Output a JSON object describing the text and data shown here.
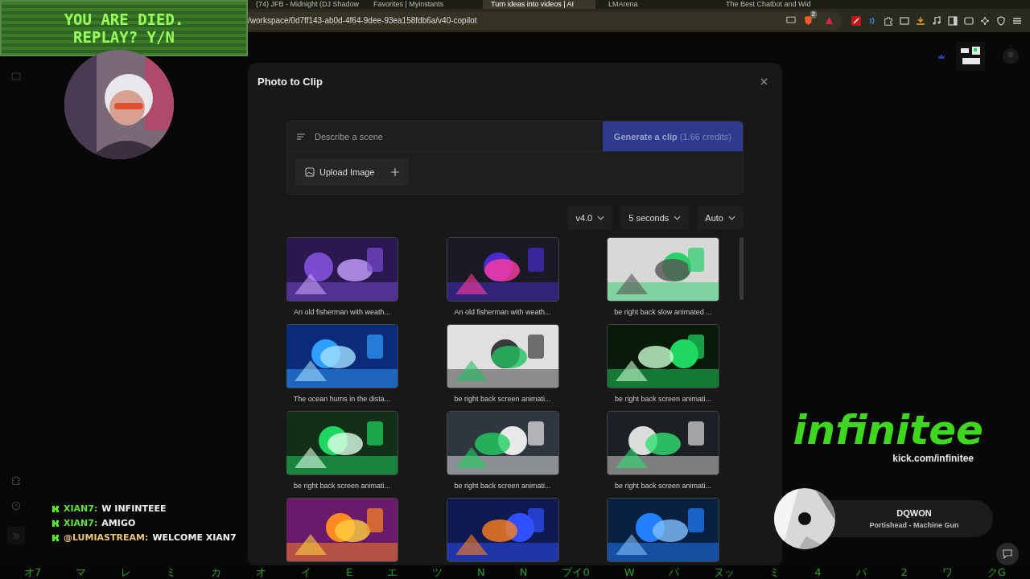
{
  "overlay_banner": {
    "line_1": "YOU ARE DIED.",
    "line_2": "REPLAY? Y/N"
  },
  "browser": {
    "tabs": [
      {
        "title": "(74) JFB - Midnight (DJ Shadow",
        "selected": false
      },
      {
        "title": "Favorites | Myinstants",
        "selected": false
      },
      {
        "title": "Turn ideas into videos | AI",
        "selected": true
      },
      {
        "title": "LMArena",
        "selected": false
      },
      {
        "title": "The Best Chatbot and Wid",
        "selected": false
      }
    ],
    "url": "/workspace/0d7ff143-ab0d-4f64-9dee-93ea158fdb6a/v40-copilot",
    "shield_badge": "2"
  },
  "modal": {
    "title": "Photo to Clip",
    "prompt": {
      "placeholder": "Describe a scene",
      "button": "Generate a clip",
      "credits": "(1.66 credits)",
      "upload": "Upload Image"
    },
    "options": [
      {
        "label": "v4.0"
      },
      {
        "label": "5 seconds"
      },
      {
        "label": "Auto"
      }
    ],
    "gallery": [
      {
        "kind": "clip",
        "caption": "An old fisherman with weath..."
      },
      {
        "kind": "clip",
        "caption": "An old fisherman with weath..."
      },
      {
        "kind": "clip",
        "caption": "be right back slow animated ..."
      },
      {
        "kind": "clip",
        "caption": "The ocean hums in the dista..."
      },
      {
        "kind": "clip",
        "caption": "be right back screen animati..."
      },
      {
        "kind": "clip",
        "caption": "be right back screen animati..."
      },
      {
        "kind": "clip",
        "caption": "be right back screen animati..."
      },
      {
        "kind": "clip",
        "caption": "be right back screen animati..."
      },
      {
        "kind": "clip",
        "caption": "be right back screen animati..."
      },
      {
        "kind": "picture"
      },
      {
        "kind": "picture"
      },
      {
        "kind": "picture"
      }
    ]
  },
  "chat": [
    {
      "user": "XIAN7:",
      "message": "W INFINTEEE",
      "color": "#5fe03a"
    },
    {
      "user": "XIAN7:",
      "message": "AMIGO",
      "color": "#5fe03a"
    },
    {
      "user": "@LUMIASTREAM:",
      "message": "WELCOME XIAN7",
      "color": "#e8c47a"
    }
  ],
  "brand": {
    "logo": "infinitee",
    "link": "kick.com/infinitee"
  },
  "now_playing": {
    "artist": "DQWON",
    "track": "Portishead - Machine Gun"
  },
  "matrix_strip": [
    "オ7",
    "マ",
    "レ",
    "ミ",
    "カ",
    "オ",
    "イ",
    "E",
    "エ",
    "ツ",
    "N",
    "N",
    "プイ0",
    "W",
    "パ",
    "ヌッ",
    "ミ",
    "4",
    "パ",
    "2",
    "ワ",
    "クG"
  ]
}
